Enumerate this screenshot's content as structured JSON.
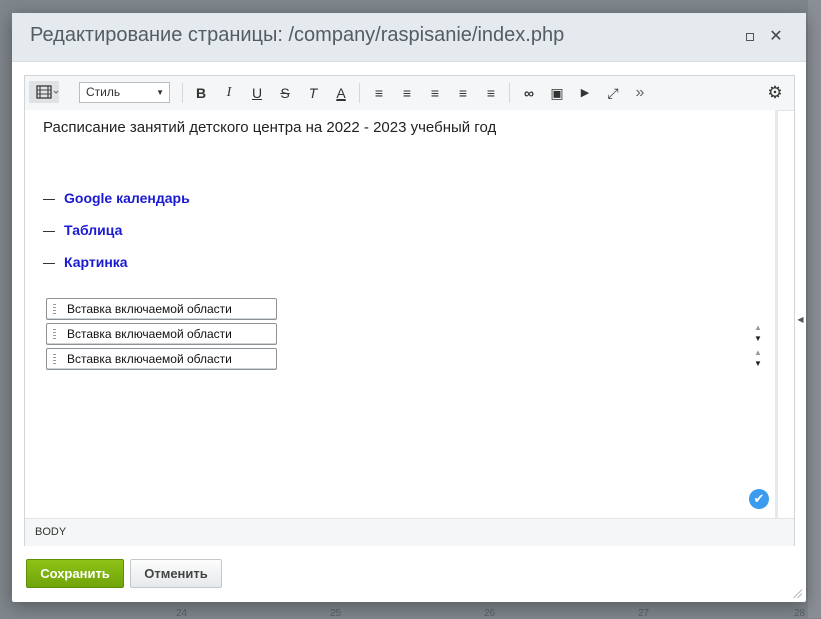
{
  "dialog": {
    "title": "Редактирование страницы: /company/raspisanie/index.php",
    "maximize_label": "",
    "close_label": "✕"
  },
  "toolbar": {
    "style_select_value": "Стиль",
    "buttons": [
      {
        "name": "bold-icon",
        "glyph": "B"
      },
      {
        "name": "italic-icon",
        "glyph": "I"
      },
      {
        "name": "underline-icon",
        "glyph": "U"
      },
      {
        "name": "strikethrough-icon",
        "glyph": "S"
      },
      {
        "name": "remove-format-icon",
        "glyph": "T"
      },
      {
        "name": "text-color-icon",
        "glyph": "A"
      },
      {
        "name": "ordered-list-icon",
        "glyph": "≡"
      },
      {
        "name": "unordered-list-icon",
        "glyph": "≡"
      },
      {
        "name": "indent-icon",
        "glyph": "≡"
      },
      {
        "name": "outdent-icon",
        "glyph": "≡"
      },
      {
        "name": "align-icon",
        "glyph": "≡"
      },
      {
        "name": "link-icon",
        "glyph": "∞"
      },
      {
        "name": "image-icon",
        "glyph": "▣"
      },
      {
        "name": "video-icon",
        "glyph": "▶"
      },
      {
        "name": "fullscreen-icon",
        "glyph": "⤢"
      },
      {
        "name": "more-icon",
        "glyph": "»"
      }
    ]
  },
  "content": {
    "intro_text": "Расписание занятий детского центра на 2022 - 2023 учебный год",
    "links": [
      "Google календарь",
      "Таблица",
      "Картинка"
    ],
    "include_blocks": [
      "Вставка включаемой области",
      "Вставка включаемой области",
      "Вставка включаемой области"
    ]
  },
  "status": {
    "tag_path": "BODY"
  },
  "footer": {
    "save_label": "Сохранить",
    "cancel_label": "Отменить"
  },
  "background": {
    "bottom_numbers": [
      "24",
      "25",
      "26",
      "27",
      "28"
    ]
  },
  "colors": {
    "link": "#1a1ad2",
    "save_button": "#7fb20f",
    "check_badge": "#3b9bee"
  }
}
